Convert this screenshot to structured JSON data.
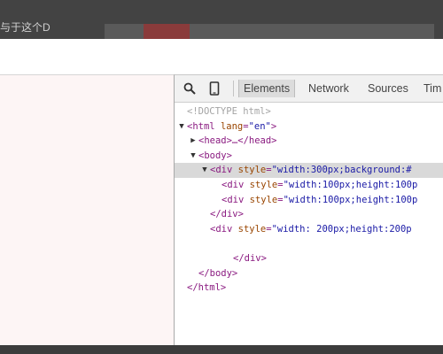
{
  "caption": "与于这个D",
  "devtools": {
    "tabs": [
      "Elements",
      "Network",
      "Sources",
      "Tim"
    ],
    "active_tab": "Elements",
    "icons": [
      "search-icon",
      "device-mode-icon"
    ]
  },
  "tree": [
    {
      "indent": 0,
      "twisty": "",
      "kind": "doctype",
      "text": "<!DOCTYPE html>"
    },
    {
      "indent": 0,
      "twisty": "▼",
      "kind": "open",
      "tag": "html",
      "attr": "lang",
      "val": "\"en\"",
      "tail": ">"
    },
    {
      "indent": 1,
      "twisty": "▶",
      "kind": "collapsed",
      "tag": "head",
      "text": "<head>…</head>"
    },
    {
      "indent": 1,
      "twisty": "▼",
      "kind": "open",
      "tag": "body",
      "attr": "",
      "val": "",
      "tail": ">"
    },
    {
      "indent": 2,
      "twisty": "▼",
      "kind": "open",
      "tag": "div",
      "attr": "style",
      "val": "\"width:300px;background:#",
      "tail": "",
      "selected": true
    },
    {
      "indent": 3,
      "twisty": "",
      "kind": "open",
      "tag": "div",
      "attr": "style",
      "val": "\"width:100px;height:100p",
      "tail": ""
    },
    {
      "indent": 3,
      "twisty": "",
      "kind": "open",
      "tag": "div",
      "attr": "style",
      "val": "\"width:100px;height:100p",
      "tail": ""
    },
    {
      "indent": 2,
      "twisty": "",
      "kind": "close",
      "text": "</div>"
    },
    {
      "indent": 2,
      "twisty": "",
      "kind": "open",
      "tag": "div",
      "attr": "style",
      "val": "\"width: 200px;height:200p",
      "tail": ""
    },
    {
      "indent": 0,
      "twisty": "",
      "kind": "blank",
      "text": ""
    },
    {
      "indent": 4,
      "twisty": "",
      "kind": "close",
      "text": "</div>"
    },
    {
      "indent": 1,
      "twisty": "",
      "kind": "close",
      "text": "</body>"
    },
    {
      "indent": 0,
      "twisty": "",
      "kind": "close",
      "text": "</html>"
    }
  ]
}
